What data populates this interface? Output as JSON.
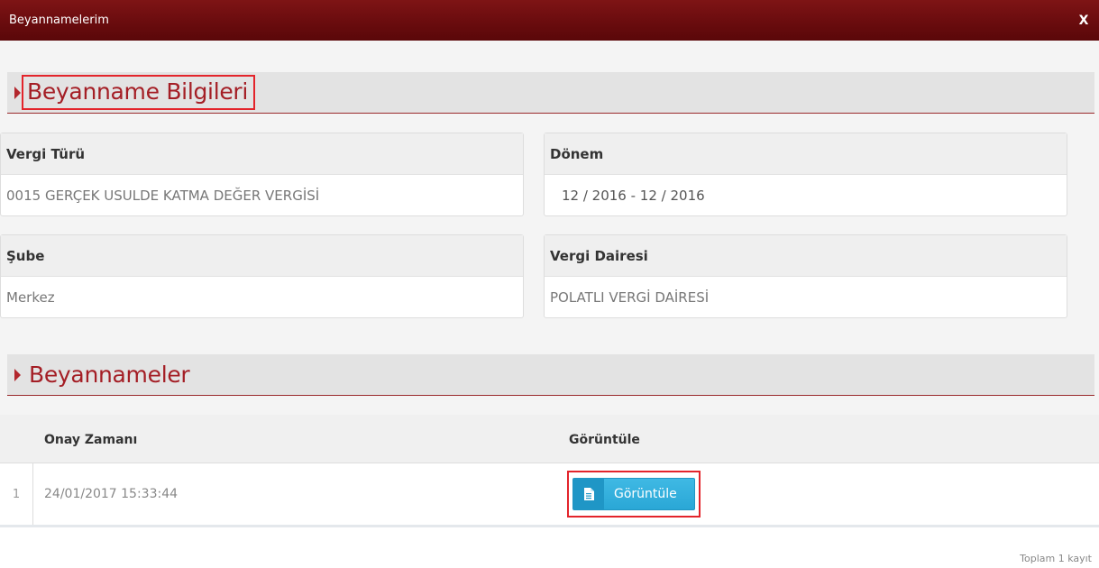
{
  "window": {
    "title": "Beyannamelerim",
    "close_label": "X"
  },
  "sections": {
    "info": {
      "title": "Beyanname Bilgileri"
    },
    "list": {
      "title": "Beyannameler"
    }
  },
  "fields": {
    "vergi_turu": {
      "label": "Vergi Türü",
      "value": "0015 GERÇEK USULDE KATMA DEĞER VERGİSİ"
    },
    "donem": {
      "label": "Dönem",
      "value": "12 / 2016 - 12 / 2016"
    },
    "sube": {
      "label": "Şube",
      "value": "Merkez"
    },
    "vergi_dairesi": {
      "label": "Vergi Dairesi",
      "value": "POLATLI VERGİ DAİRESİ"
    }
  },
  "table": {
    "columns": [
      "Onay Zamanı",
      "Görüntüle"
    ],
    "rows": [
      {
        "index": "1",
        "onay_zamani": "24/01/2017 15:33:44",
        "button_label": "Görüntüle"
      }
    ],
    "total_text": "Toplam 1 kayıt"
  },
  "icons": {
    "view_button_icon": "document-icon"
  },
  "colors": {
    "titlebar": "#6a0c0e",
    "section_title": "#a41e25",
    "button": "#2aa7d6",
    "highlight": "#e3242b"
  }
}
